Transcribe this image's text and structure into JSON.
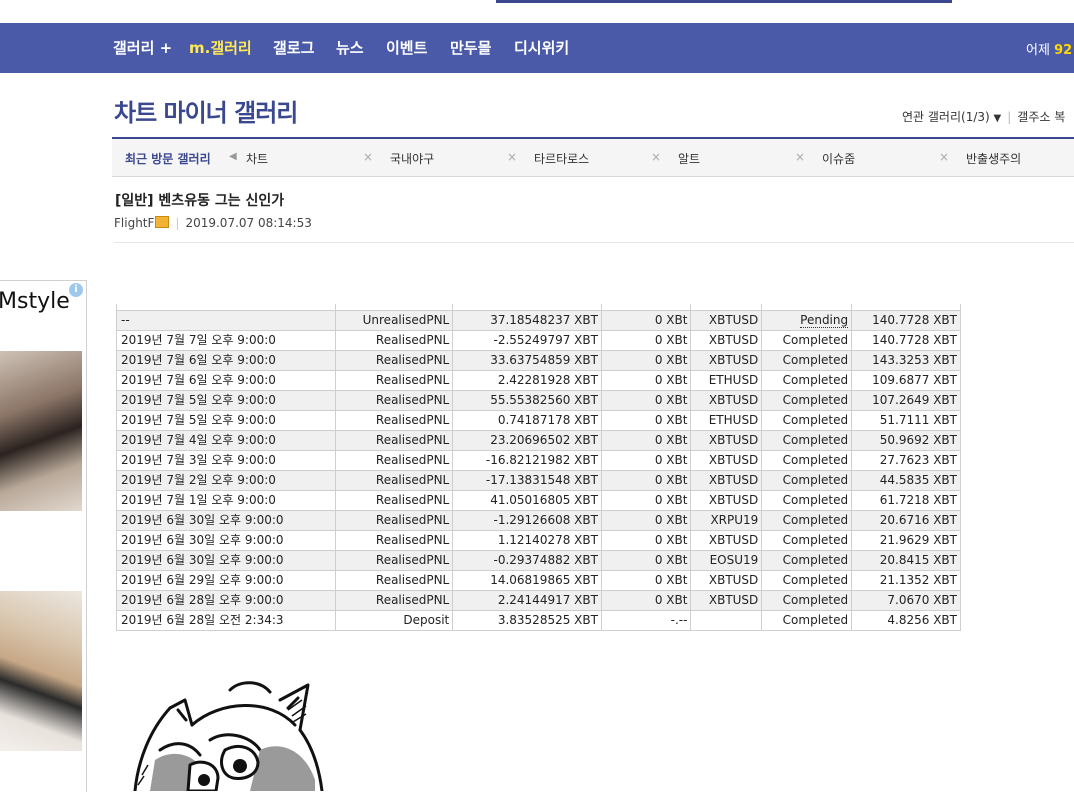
{
  "nav": {
    "items": [
      {
        "label": "갤러리 +",
        "active": false
      },
      {
        "label": "m.갤러리",
        "active": true
      },
      {
        "label": "갤로그",
        "active": false
      },
      {
        "label": "뉴스",
        "active": false
      },
      {
        "label": "이벤트",
        "active": false
      },
      {
        "label": "만두몰",
        "active": false
      },
      {
        "label": "디시위키",
        "active": false
      }
    ],
    "right_label": "어제",
    "right_value": "92"
  },
  "gallery": {
    "title": "차트 마이너 갤러리",
    "related_label": "연관 갤러리(1/3)",
    "address_label": "갤주소 복"
  },
  "recent": {
    "label": "최근 방문 갤러리",
    "items": [
      "차트",
      "국내야구",
      "타르타로스",
      "알트",
      "이슈줌",
      "반출생주의"
    ],
    "close_glyph": "×"
  },
  "post": {
    "title": "[일반] 벤츠유동 그는 신인가",
    "author": "FlightF",
    "datetime": "2019.07.07 08:14:53"
  },
  "ad": {
    "brand": "Mstyle",
    "info_glyph": "i"
  },
  "table": {
    "rows": [
      {
        "time": "--",
        "type": "UnrealisedPNL",
        "amount": "37.18548237 XBT",
        "fee": "0 XBt",
        "symbol": "XBTUSD",
        "status": "Pending",
        "balance": "140.7728 XBT"
      },
      {
        "time": "2019년 7월 7일 오후 9:00:0",
        "type": "RealisedPNL",
        "amount": "-2.55249797 XBT",
        "fee": "0 XBt",
        "symbol": "XBTUSD",
        "status": "Completed",
        "balance": "140.7728 XBT"
      },
      {
        "time": "2019년 7월 6일 오후 9:00:0",
        "type": "RealisedPNL",
        "amount": "33.63754859 XBT",
        "fee": "0 XBt",
        "symbol": "XBTUSD",
        "status": "Completed",
        "balance": "143.3253 XBT"
      },
      {
        "time": "2019년 7월 6일 오후 9:00:0",
        "type": "RealisedPNL",
        "amount": "2.42281928 XBT",
        "fee": "0 XBt",
        "symbol": "ETHUSD",
        "status": "Completed",
        "balance": "109.6877 XBT"
      },
      {
        "time": "2019년 7월 5일 오후 9:00:0",
        "type": "RealisedPNL",
        "amount": "55.55382560 XBT",
        "fee": "0 XBt",
        "symbol": "XBTUSD",
        "status": "Completed",
        "balance": "107.2649 XBT"
      },
      {
        "time": "2019년 7월 5일 오후 9:00:0",
        "type": "RealisedPNL",
        "amount": "0.74187178 XBT",
        "fee": "0 XBt",
        "symbol": "ETHUSD",
        "status": "Completed",
        "balance": "51.7111 XBT"
      },
      {
        "time": "2019년 7월 4일 오후 9:00:0",
        "type": "RealisedPNL",
        "amount": "23.20696502 XBT",
        "fee": "0 XBt",
        "symbol": "XBTUSD",
        "status": "Completed",
        "balance": "50.9692 XBT"
      },
      {
        "time": "2019년 7월 3일 오후 9:00:0",
        "type": "RealisedPNL",
        "amount": "-16.82121982 XBT",
        "fee": "0 XBt",
        "symbol": "XBTUSD",
        "status": "Completed",
        "balance": "27.7623 XBT"
      },
      {
        "time": "2019년 7월 2일 오후 9:00:0",
        "type": "RealisedPNL",
        "amount": "-17.13831548 XBT",
        "fee": "0 XBt",
        "symbol": "XBTUSD",
        "status": "Completed",
        "balance": "44.5835 XBT"
      },
      {
        "time": "2019년 7월 1일 오후 9:00:0",
        "type": "RealisedPNL",
        "amount": "41.05016805 XBT",
        "fee": "0 XBt",
        "symbol": "XBTUSD",
        "status": "Completed",
        "balance": "61.7218 XBT"
      },
      {
        "time": "2019년 6월 30일 오후 9:00:0",
        "type": "RealisedPNL",
        "amount": "-1.29126608 XBT",
        "fee": "0 XBt",
        "symbol": "XRPU19",
        "status": "Completed",
        "balance": "20.6716 XBT"
      },
      {
        "time": "2019년 6월 30일 오후 9:00:0",
        "type": "RealisedPNL",
        "amount": "1.12140278 XBT",
        "fee": "0 XBt",
        "symbol": "XBTUSD",
        "status": "Completed",
        "balance": "21.9629 XBT"
      },
      {
        "time": "2019년 6월 30일 오후 9:00:0",
        "type": "RealisedPNL",
        "amount": "-0.29374882 XBT",
        "fee": "0 XBt",
        "symbol": "EOSU19",
        "status": "Completed",
        "balance": "20.8415 XBT"
      },
      {
        "time": "2019년 6월 29일 오후 9:00:0",
        "type": "RealisedPNL",
        "amount": "14.06819865 XBT",
        "fee": "0 XBt",
        "symbol": "XBTUSD",
        "status": "Completed",
        "balance": "21.1352 XBT"
      },
      {
        "time": "2019년 6월 28일 오후 9:00:0",
        "type": "RealisedPNL",
        "amount": "2.24144917 XBT",
        "fee": "0 XBt",
        "symbol": "XBTUSD",
        "status": "Completed",
        "balance": "7.0670 XBT"
      },
      {
        "time": "2019년 6월 28일 오전 2:34:3",
        "type": "Deposit",
        "amount": "3.83528525 XBT",
        "fee": "-.--",
        "symbol": "",
        "status": "Completed",
        "balance": "4.8256 XBT"
      }
    ]
  },
  "colors": {
    "nav_bg": "#4a5aa8",
    "nav_active": "#ffe955",
    "brand_blue": "#3b4890"
  }
}
